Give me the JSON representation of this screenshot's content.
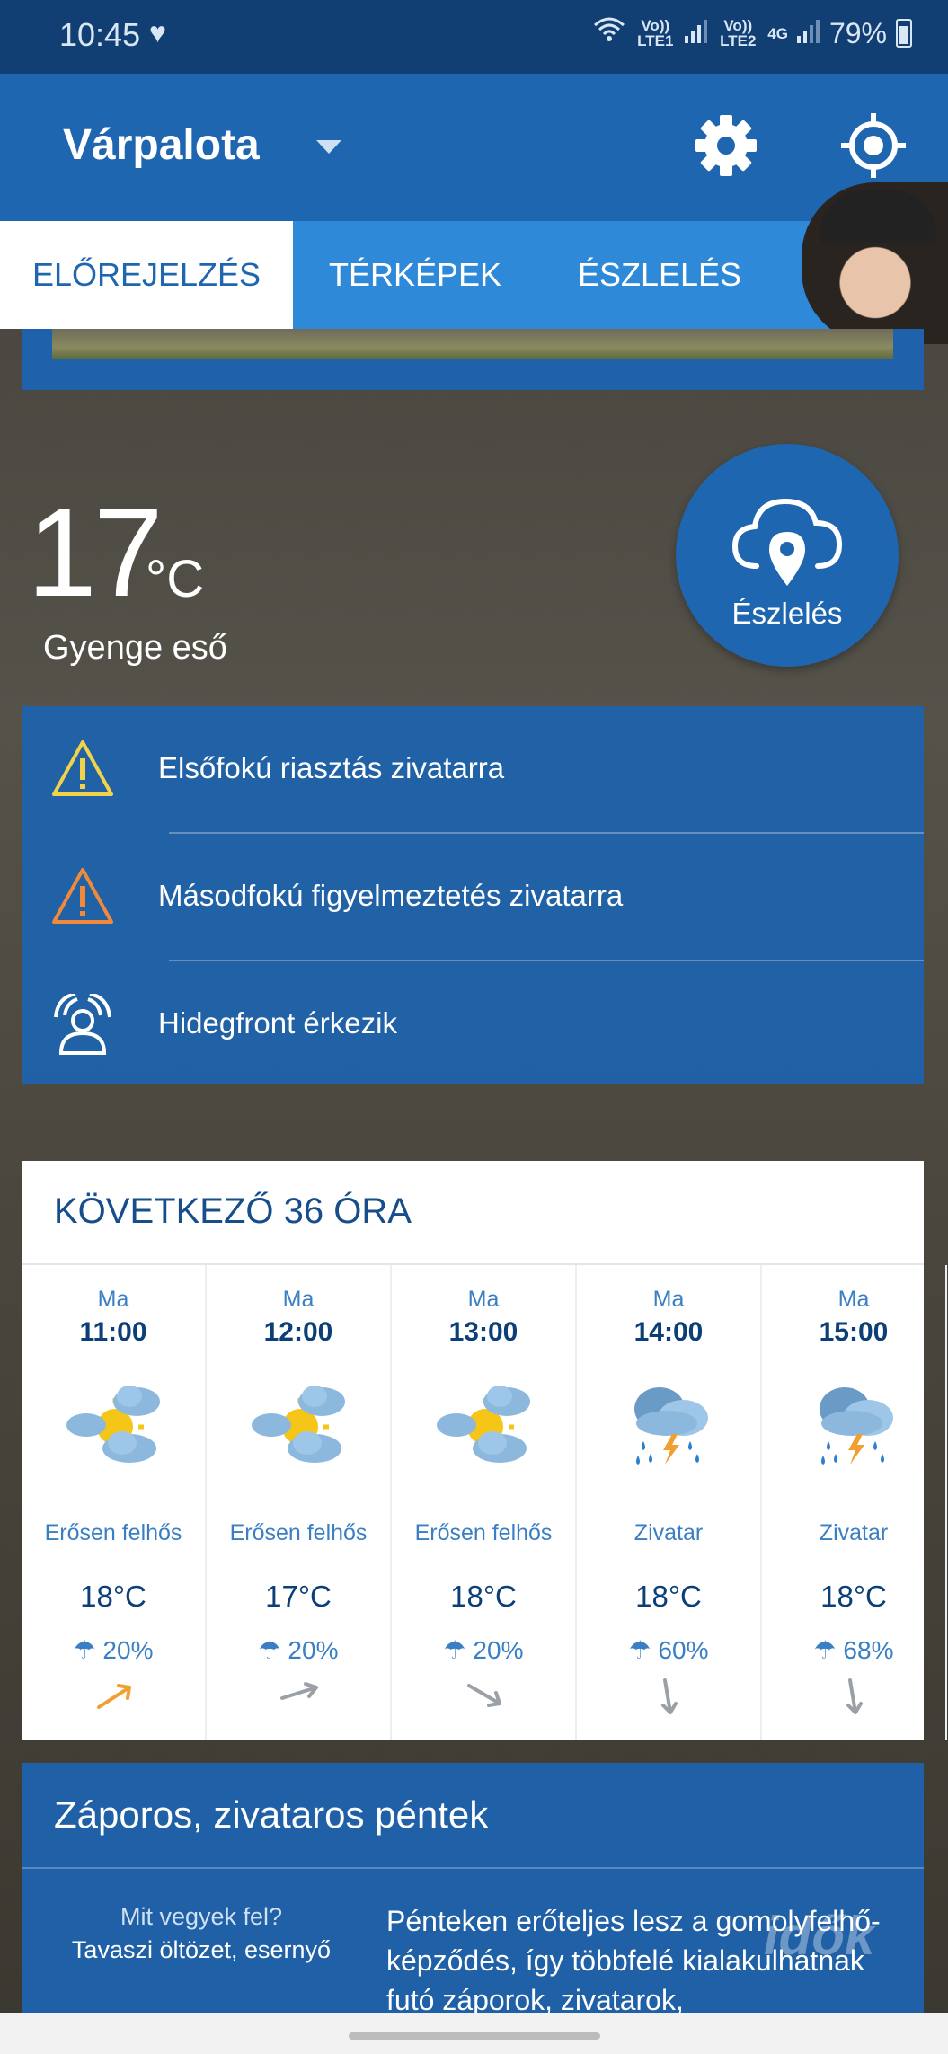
{
  "status_bar": {
    "time": "10:45",
    "volte1": "Vo)) LTE1",
    "volte2": "Vo)) LTE2",
    "network": "4G",
    "battery": "79%"
  },
  "app_bar": {
    "city": "Várpalota"
  },
  "tabs": [
    {
      "label": "ELŐREJELZÉS",
      "active": true
    },
    {
      "label": "TÉRKÉPEK",
      "active": false
    },
    {
      "label": "ÉSZLELÉS",
      "active": false
    }
  ],
  "current": {
    "temp": "17",
    "unit": "°C",
    "condition": "Gyenge eső"
  },
  "observe_button": {
    "label": "Észlelés"
  },
  "alerts": [
    {
      "text": "Elsőfokú riasztás zivatarra",
      "icon": "warning-yellow-icon",
      "color": "#f2d24a"
    },
    {
      "text": "Másodfokú figyelmeztetés zivatarra",
      "icon": "warning-orange-icon",
      "color": "#f08a3a"
    },
    {
      "text": "Hidegfront érkezik",
      "icon": "cold-front-icon",
      "color": "#ffffff"
    }
  ],
  "forecast": {
    "title": "KÖVETKEZŐ 36 ÓRA",
    "hours": [
      {
        "day": "Ma",
        "hour": "11:00",
        "desc": "Erősen felhős",
        "temp": "18°C",
        "rain": "20%",
        "icon": "cloudy-sun-icon",
        "wind_color": "#f0a030"
      },
      {
        "day": "Ma",
        "hour": "12:00",
        "desc": "Erősen felhős",
        "temp": "17°C",
        "rain": "20%",
        "icon": "cloudy-sun-icon",
        "wind_color": "#9aa0a6"
      },
      {
        "day": "Ma",
        "hour": "13:00",
        "desc": "Erősen felhős",
        "temp": "18°C",
        "rain": "20%",
        "icon": "cloudy-sun-icon",
        "wind_color": "#9aa0a6"
      },
      {
        "day": "Ma",
        "hour": "14:00",
        "desc": "Zivatar",
        "temp": "18°C",
        "rain": "60%",
        "icon": "thunderstorm-icon",
        "wind_color": "#9aa0a6"
      },
      {
        "day": "Ma",
        "hour": "15:00",
        "desc": "Zivatar",
        "temp": "18°C",
        "rain": "68%",
        "icon": "thunderstorm-icon",
        "wind_color": "#9aa0a6"
      }
    ]
  },
  "article": {
    "title": "Záporos, zivataros péntek",
    "question": "Mit vegyek fel?",
    "answer": "Tavaszi öltözet, esernyő",
    "body": "Pénteken erőteljes lesz a gomolyfelhő-képződés, így többfelé kialakulhatnak futó záporok, zivatarok,"
  },
  "watermark": "idők"
}
